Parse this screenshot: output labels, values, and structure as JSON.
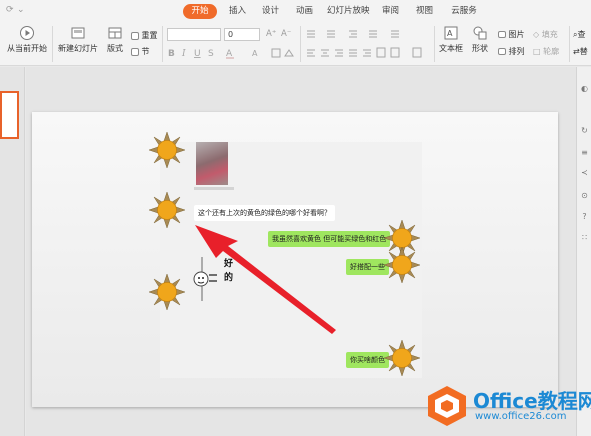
{
  "quick_access": [
    "⟳",
    "⌄",
    "⌄"
  ],
  "tabs": [
    {
      "label": "开始",
      "active": true
    },
    {
      "label": "插入",
      "active": false
    },
    {
      "label": "设计",
      "active": false
    },
    {
      "label": "动画",
      "active": false
    },
    {
      "label": "幻灯片放映",
      "active": false
    },
    {
      "label": "审阅",
      "active": false
    },
    {
      "label": "视图",
      "active": false
    },
    {
      "label": "云服务",
      "active": false
    }
  ],
  "ribbon": {
    "play_from_current": "从当前开始",
    "new_slide": "新建幻灯片",
    "layout": "版式",
    "reset": "重置",
    "section": "节",
    "font_name_value": "",
    "font_size_value": "0",
    "grow_font": "A⁺",
    "shrink_font": "A⁻",
    "textbox": "文本框",
    "shape": "形状",
    "picture": "图片",
    "fill": "填充",
    "arrange": "排列",
    "outline": "轮廓",
    "find": "查",
    "replace": "替"
  },
  "chat": {
    "question": "这个还有上次的黄色的绿色的哪个好看啊？",
    "reply1": "我虽然喜欢黄色 但可能买绿色和红色",
    "reply2": "好搭配一些",
    "reply3": "你买啥颜色",
    "emoji_text": "好的"
  },
  "watermark": {
    "title": "Office教程网",
    "url": "www.office26.com"
  },
  "colors": {
    "accent": "#f06b2a",
    "arrow": "#e8202a",
    "sun": "#f0a61b",
    "sun_rays": "#a88a54",
    "bubble_green": "#9fe65f",
    "watermark": "#1c89d4"
  }
}
